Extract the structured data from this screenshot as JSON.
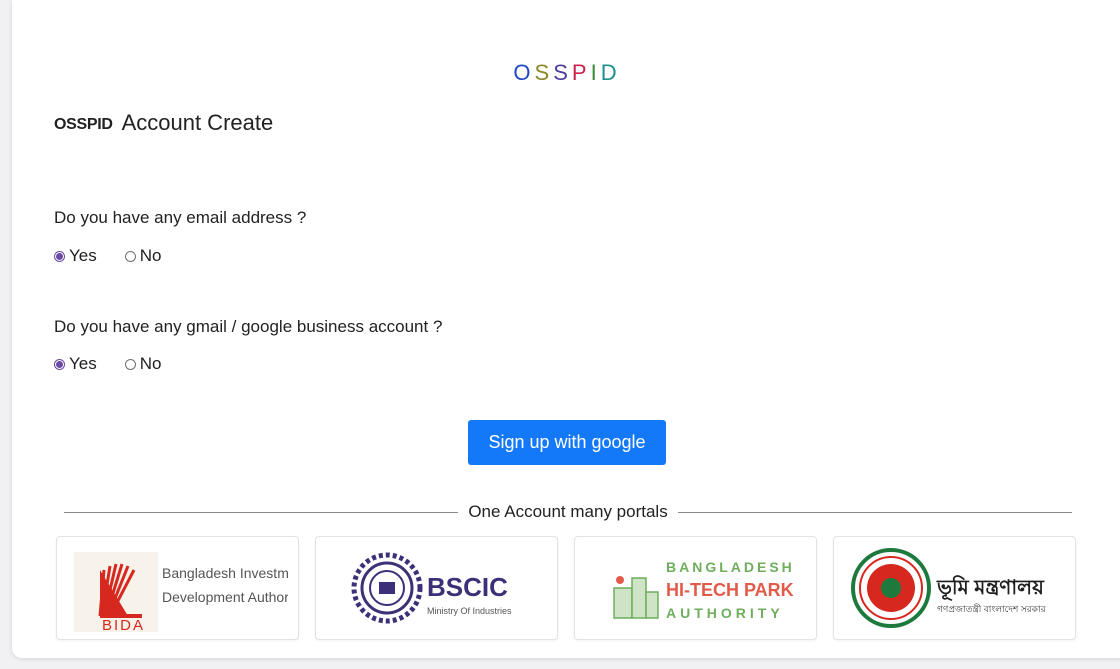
{
  "brand": {
    "letters": [
      {
        "char": "O",
        "color": "#2348c8"
      },
      {
        "char": "S",
        "color": "#8a8a2a"
      },
      {
        "char": "S",
        "color": "#4c3f9e"
      },
      {
        "char": "P",
        "color": "#c9244e"
      },
      {
        "char": "I",
        "color": "#3a8a3a"
      },
      {
        "char": "D",
        "color": "#1f8e8e"
      }
    ]
  },
  "title": {
    "strong": "OSSPID",
    "text": "Account Create"
  },
  "questions": [
    {
      "label": "Do you have any email address ?",
      "options": [
        {
          "label": "Yes",
          "checked": true
        },
        {
          "label": "No",
          "checked": false
        }
      ]
    },
    {
      "label": "Do you have any gmail / google business account ?",
      "options": [
        {
          "label": "Yes",
          "checked": true
        },
        {
          "label": "No",
          "checked": false
        }
      ]
    }
  ],
  "signup_button": {
    "label": "Sign up with google",
    "color": "#1479f8"
  },
  "divider": {
    "label": "One Account many portals"
  },
  "portals": {
    "bida": {
      "line1": "Bangladesh Investment",
      "line2": "Development Authority",
      "abbr": "BIDA"
    },
    "bscic": {
      "name": "BSCIC",
      "sub": "Ministry Of Industries"
    },
    "hitech": {
      "line1": "BANGLADESH",
      "line2": "HI-TECH PARK",
      "line3": "AUTHORITY"
    },
    "land": {
      "name": "ভূমি মন্ত্রণালয়",
      "sub": "গণপ্রজাতন্ত্রী বাংলাদেশ সরকার"
    }
  }
}
